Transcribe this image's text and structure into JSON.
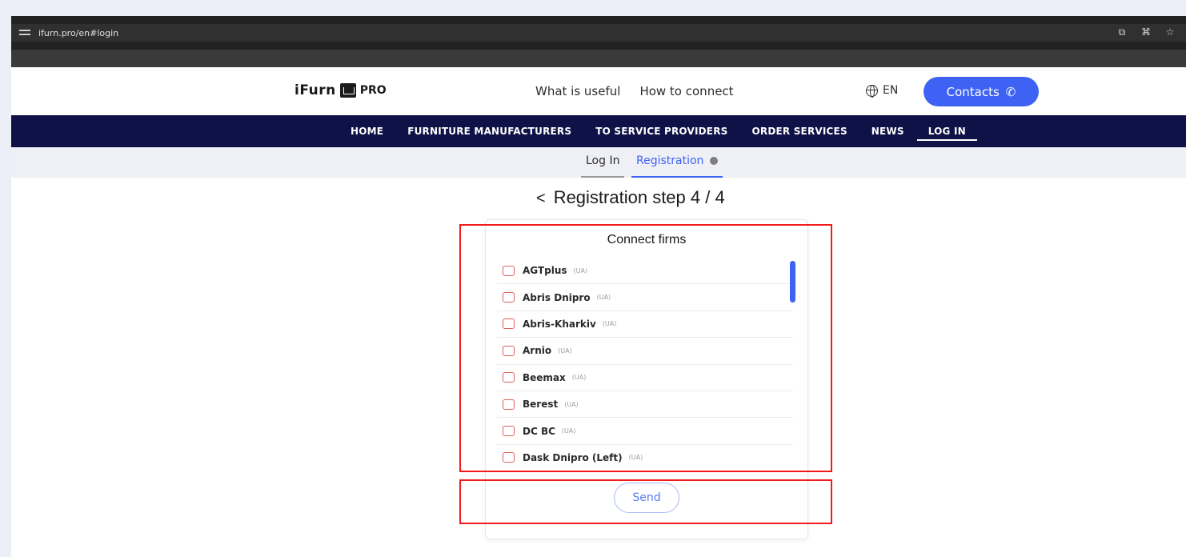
{
  "browser": {
    "url": "ifurn.pro/en#login",
    "actions": [
      "cast-icon",
      "translate-icon",
      "star-icon"
    ]
  },
  "header": {
    "logo_text": "iFurn",
    "logo_suffix": "PRO",
    "nav": [
      "What is useful",
      "How to connect"
    ],
    "language": "EN",
    "contacts_label": "Contacts",
    "accent_color": "#3e63f4"
  },
  "mainnav": {
    "items": [
      "HOME",
      "FURNITURE MANUFACTURERS",
      "TO SERVICE PROVIDERS",
      "ORDER SERVICES",
      "NEWS",
      "LOG IN"
    ],
    "active": "LOG IN",
    "background": "#0e1247"
  },
  "tabs": {
    "login": "Log In",
    "registration": "Registration"
  },
  "registration": {
    "step_title": "Registration step 4 / 4",
    "connect_title": "Connect firms",
    "firms": [
      {
        "name": "AGTplus",
        "country": "(UA)"
      },
      {
        "name": "Abris Dnipro",
        "country": "(UA)"
      },
      {
        "name": "Abris-Kharkiv",
        "country": "(UA)"
      },
      {
        "name": "Arnio",
        "country": "(UA)"
      },
      {
        "name": "Beemax",
        "country": "(UA)"
      },
      {
        "name": "Berest",
        "country": "(UA)"
      },
      {
        "name": "DC BC",
        "country": "(UA)"
      },
      {
        "name": "Dask Dnipro (Left)",
        "country": "(UA)"
      }
    ],
    "send_label": "Send"
  }
}
